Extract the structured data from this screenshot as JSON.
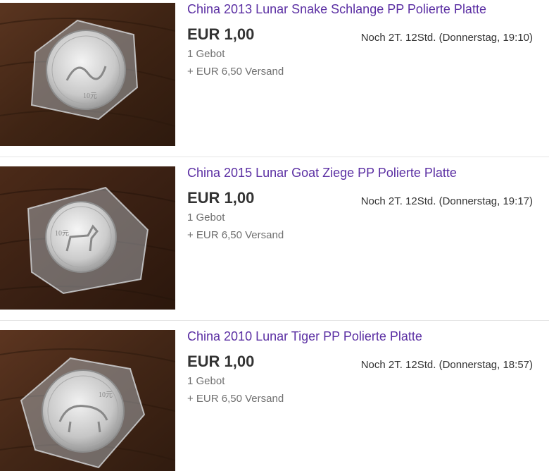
{
  "listings": [
    {
      "title": "China 2013 Lunar Snake Schlange PP Polierte Platte",
      "price": "EUR 1,00",
      "bids": "1 Gebot",
      "shipping": "+ EUR 6,50 Versand",
      "time_left": "Noch 2T. 12Std. (Donnerstag, 19:10)",
      "image": "snake-coin-photo"
    },
    {
      "title": "China 2015 Lunar Goat Ziege PP Polierte Platte",
      "price": "EUR 1,00",
      "bids": "1 Gebot",
      "shipping": "+ EUR 6,50 Versand",
      "time_left": "Noch 2T. 12Std. (Donnerstag, 19:17)",
      "image": "goat-coin-photo"
    },
    {
      "title": "China 2010 Lunar Tiger PP Polierte Platte",
      "price": "EUR 1,00",
      "bids": "1 Gebot",
      "shipping": "+ EUR 6,50 Versand",
      "time_left": "Noch 2T. 12Std. (Donnerstag, 18:57)",
      "image": "tiger-coin-photo"
    }
  ],
  "colors": {
    "title_link": "#5b2fa3",
    "price": "#333333",
    "secondary_text": "#707070",
    "separator": "#e5e5e5",
    "wood": "#4a2a19"
  }
}
